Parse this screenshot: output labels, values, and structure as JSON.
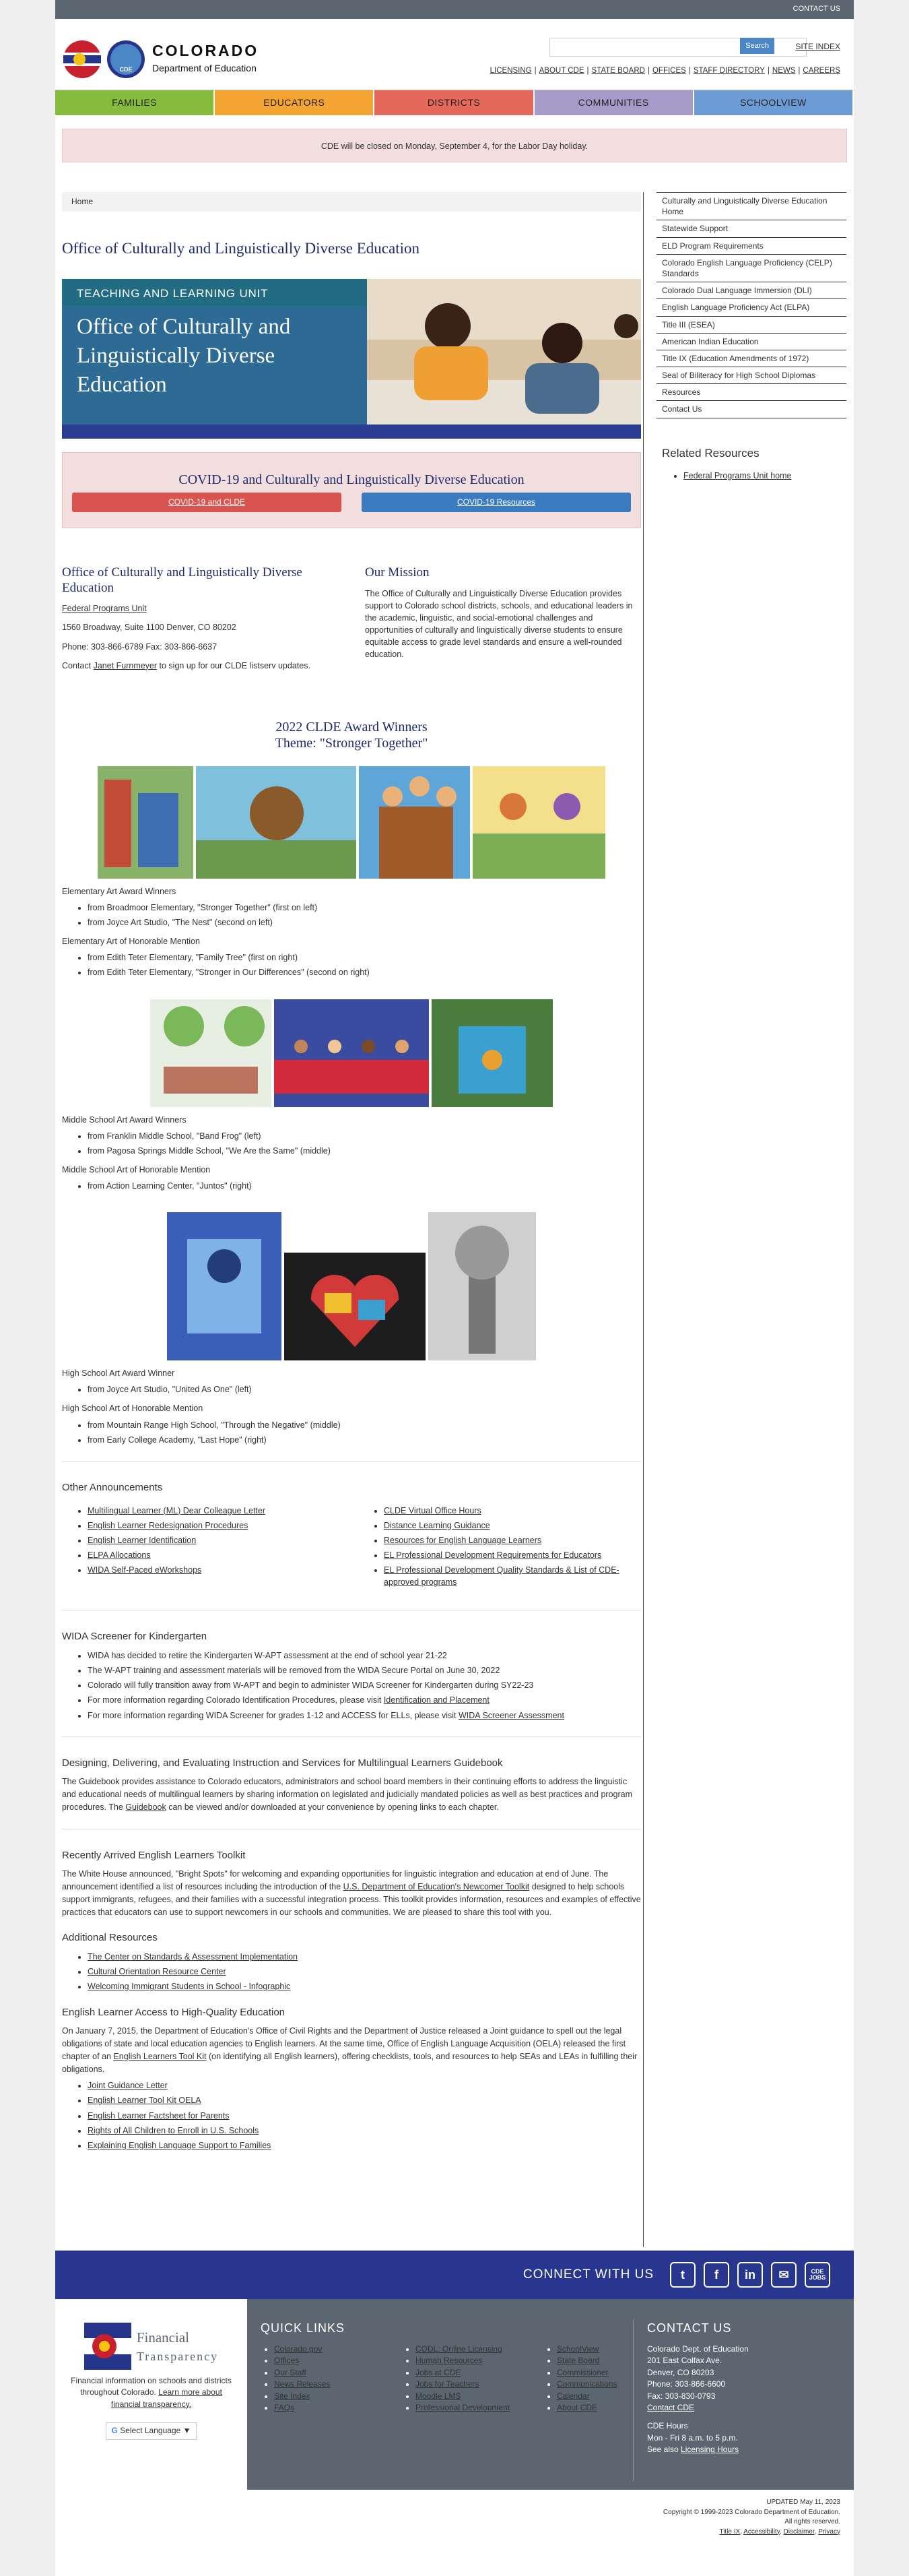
{
  "topbar": {
    "contact": "CONTACT US"
  },
  "header": {
    "logo_state": "COLORADO",
    "logo_dept": "Department of Education",
    "search_placeholder": "",
    "search_btn": "Search",
    "site_index": "SITE INDEX",
    "links": [
      "LICENSING",
      "ABOUT CDE",
      "STATE BOARD",
      "OFFICES",
      "STAFF DIRECTORY",
      "NEWS",
      "CAREERS"
    ]
  },
  "nav": [
    {
      "label": "FAMILIES",
      "color": "#86bb3d"
    },
    {
      "label": "EDUCATORS",
      "color": "#f4a432"
    },
    {
      "label": "DISTRICTS",
      "color": "#e5695a"
    },
    {
      "label": "COMMUNITIES",
      "color": "#a69ac8"
    },
    {
      "label": "SCHOOLview",
      "color": "#6d9bd5"
    }
  ],
  "alert": "CDE will be closed on Monday, September 4, for the Labor Day holiday.",
  "breadcrumb": "Home",
  "page_title": "Office of Culturally and Linguistically Diverse Education",
  "hero": {
    "unit": "TEACHING AND LEARNING UNIT",
    "title": "Office of Culturally and Linguistically Diverse Education"
  },
  "covid": {
    "title": "COVID-19 and Culturally and Linguistically Diverse Education",
    "btn1": "COVID-19 and CLDE",
    "btn2": "COVID-19 Resources"
  },
  "office": {
    "title": "Office of Culturally and Linguistically Diverse Education",
    "unit_link": "Federal Programs Unit",
    "address": "1560 Broadway, Suite 1100 Denver, CO 80202",
    "phone": "Phone: 303-866-6789 Fax: 303-866-6637",
    "contact_pre": "Contact ",
    "contact_name": "Janet Furnmeyer",
    "contact_post": " to sign up for our CLDE listserv updates."
  },
  "mission": {
    "title": "Our Mission",
    "text": "The Office of Culturally and Linguistically Diverse Education provides support to Colorado school districts, schools, and educational leaders in the academic, linguistic, and social-emotional challenges and opportunities of culturally and linguistically diverse students to ensure equitable access to grade level standards and ensure a well-rounded education."
  },
  "award": {
    "title1": "2022 CLDE Award Winners",
    "title2": "Theme: \"Stronger Together\"",
    "elem_winners": "Elementary Art Award Winners",
    "elem_w": [
      "from Broadmoor Elementary, \"Stronger Together\" (first on left)",
      "from Joyce Art Studio, \"The Nest\" (second on left)"
    ],
    "elem_hm": "Elementary Art of Honorable Mention",
    "elem_h": [
      "from Edith Teter Elementary, \"Family Tree\" (first on right)",
      "from Edith Teter Elementary, \"Stronger in Our Differences\" (second on right)"
    ],
    "mid_winners": "Middle School Art Award Winners",
    "mid_w": [
      "from Franklin Middle School, \"Band Frog\" (left)",
      "from Pagosa Springs Middle School, \"We Are the Same\" (middle)"
    ],
    "mid_hm": "Middle School Art of Honorable Mention",
    "mid_h": [
      "from Action Learning Center, \"Juntos\" (right)"
    ],
    "high_winners": "High School Art Award Winner",
    "high_w": [
      "from Joyce Art Studio, \"United As One\" (left)"
    ],
    "high_hm": "High School Art of Honorable Mention",
    "high_h": [
      "from Mountain Range High School, \"Through the Negative\" (middle)",
      "from Early College Academy, \"Last Hope\" (right)"
    ]
  },
  "other": {
    "title": "Other Announcements",
    "left": [
      "Multilingual Learner (ML) Dear Colleague Letter",
      "English Learner Redesignation Procedures",
      "English Learner Identification",
      "ELPA Allocations",
      "WIDA Self-Paced eWorkshops"
    ],
    "right": [
      "CLDE Virtual Office Hours",
      "Distance Learning Guidance",
      "Resources for English Language Learners",
      "EL Professional Development Requirements for Educators",
      "EL Professional Development Quality Standards & List of CDE-approved programs"
    ]
  },
  "wida": {
    "title": "WIDA Screener for Kindergarten",
    "items": [
      "WIDA has decided to retire the Kindergarten W-APT assessment at the end of school year 21-22",
      "The W-APT training and assessment materials will be removed from the WIDA Secure Portal on June 30, 2022",
      "Colorado will fully transition away from W-APT and begin to administer WIDA Screener for Kindergarten during SY22-23"
    ],
    "item4_pre": "For more information regarding Colorado Identification Procedures, please visit ",
    "item4_link": "Identification and Placement",
    "item5_pre": "For more information regarding WIDA Screener for grades 1-12 and ACCESS for ELLs, please visit ",
    "item5_link": "WIDA Screener Assessment"
  },
  "guide": {
    "title": "Designing, Delivering, and Evaluating Instruction and Services for Multilingual Learners Guidebook",
    "text_pre": "The Guidebook provides assistance to Colorado educators, administrators and school board members in their continuing efforts to address the linguistic and educational needs of multilingual learners by sharing information on legislated and judicially mandated policies as well as best practices and program procedures. The ",
    "text_link": "Guidebook",
    "text_post": " can be viewed and/or downloaded at your convenience by opening links to each chapter."
  },
  "toolkit": {
    "title": "Recently Arrived English Learners Toolkit",
    "text_pre": "The White House announced, \"Bright Spots\" for welcoming and expanding opportunities for linguistic integration and education at end of June. The announcement identified a list of resources including the introduction of the ",
    "text_link": "U.S. Department of Education's Newcomer Toolkit",
    "text_post": " designed to help schools support immigrants, refugees, and their families with a successful integration process. This toolkit provides information, resources and examples of effective practices that educators can use to support newcomers in our schools and communities. We are pleased to share this tool with you."
  },
  "additional": {
    "title": "Additional Resources",
    "items": [
      "The Center on Standards & Assessment Implementation",
      "Cultural Orientation Resource Center",
      "Welcoming Immigrant Students in School - Infographic"
    ]
  },
  "access": {
    "title": "English Learner Access to High-Quality Education",
    "text_pre": "On January 7, 2015, the Department of Education's Office of Civil Rights and the Department of Justice released a Joint guidance to spell out the legal obligations of state and local education agencies to English learners. At the same time, Office of English Language Acquisition (OELA) released the first chapter of an ",
    "text_link": "English Learners Tool Kit",
    "text_post": " (on identifying all English learners), offering checklists, tools, and resources to help SEAs and LEAs in fulfilling their obligations.",
    "items": [
      "Joint Guidance Letter",
      "English Learner Tool Kit OELA",
      "English Learner Factsheet for Parents",
      "Rights of All Children to Enroll in U.S. Schools",
      "Explaining English Language Support to Families"
    ]
  },
  "sidebar": {
    "items": [
      "Culturally and Linguistically Diverse Education Home",
      "Statewide Support",
      "ELD Program Requirements",
      "Colorado English Language Proficiency (CELP) Standards",
      "Colorado Dual Language Immersion (DLI)",
      "English Language Proficiency Act (ELPA)",
      "Title III (ESEA)",
      "American Indian Education",
      "Title IX (Education Amendments of 1972)",
      "Seal of Biliteracy for High School Diplomas",
      "Resources",
      "Contact Us"
    ],
    "related_title": "Related Resources",
    "related": [
      "Federal Programs Unit home"
    ]
  },
  "connect": {
    "label": "CONNECT WITH US",
    "jobs": "CDE JOBS"
  },
  "footer": {
    "ft_title": "Financial",
    "ft_title2": "Transparency",
    "ft_text_pre": "Financial information on schools and districts throughout Colorado. ",
    "ft_link": "Learn more about financial transparency.",
    "lang": "Select Language",
    "quick_title": "QUICK LINKS",
    "quick1": [
      "Colorado.gov",
      "Offices",
      "Our Staff",
      "News Releases",
      "Site Index",
      "FAQs"
    ],
    "quick2": [
      "CODL: Online Licensing",
      "Human Resources",
      "Jobs at CDE",
      "Jobs for Teachers",
      "Moodle LMS",
      "Professional Development"
    ],
    "quick3": [
      "SchoolView",
      "State Board",
      "Commissioner",
      "Communications",
      "Calendar",
      "About CDE"
    ],
    "contact_title": "CONTACT US",
    "contact": [
      "Colorado Dept. of Education",
      "201 East Colfax Ave.",
      "Denver, CO 80203",
      "Phone: 303-866-6600",
      "Fax: 303-830-0793"
    ],
    "contact_link": "Contact CDE",
    "hours_title": "CDE Hours",
    "hours": "Mon - Fri 8 a.m. to 5 p.m.",
    "see_pre": "See also ",
    "see_link": "Licensing Hours"
  },
  "bottom": {
    "updated": "UPDATED May 11, 2023",
    "copyright": "Copyright © 1999-2023 Colorado Department of Education.",
    "rights": "All rights reserved.",
    "links": [
      "Title IX",
      "Accessibility",
      "Disclaimer",
      "Privacy"
    ]
  }
}
